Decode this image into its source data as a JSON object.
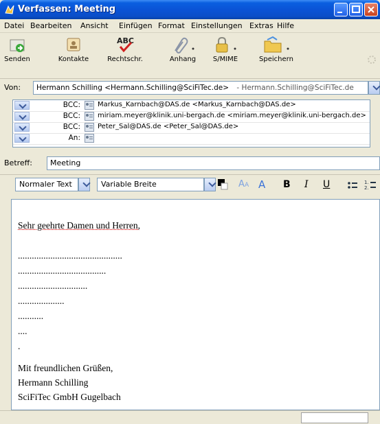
{
  "window": {
    "title": "Verfassen: Meeting"
  },
  "menu": [
    {
      "label": "Datei"
    },
    {
      "label": "Bearbeiten"
    },
    {
      "label": "Ansicht"
    },
    {
      "label": "Einfügen"
    },
    {
      "label": "Format"
    },
    {
      "label": "Einstellungen"
    },
    {
      "label": "Extras"
    },
    {
      "label": "Hilfe"
    }
  ],
  "toolbar": {
    "send": "Senden",
    "contacts": "Kontakte",
    "spell": "Rechtschr.",
    "attach": "Anhang",
    "smime": "S/MIME",
    "save": "Speichern"
  },
  "from": {
    "label": "Von:",
    "value": "Hermann Schilling <Hermann.Schilling@SciFiTec.de>",
    "account": "- Hermann.Schilling@SciFiTec.de"
  },
  "recipients": [
    {
      "type": "BCC:",
      "address": "Markus_Karnbach@DAS.de <Markus_Karnbach@DAS.de>"
    },
    {
      "type": "BCC:",
      "address": "miriam.meyer@klinik.uni-bergach.de <miriam.meyer@klinik.uni-bergach.de>"
    },
    {
      "type": "BCC:",
      "address": "Peter_Sal@DAS.de <Peter_Sal@DAS.de>"
    },
    {
      "type": "An:",
      "address": ""
    }
  ],
  "subject": {
    "label": "Betreff:",
    "value": "Meeting"
  },
  "format": {
    "paragraph": "Normaler Text",
    "font": "Variable Breite",
    "bold": "B",
    "italic": "I",
    "underline": "U"
  },
  "body": {
    "greeting": "Sehr geehrte Damen und Herren,",
    "dots": [
      ".............................................",
      "......................................",
      "..............................",
      "....................",
      "...........",
      "....",
      "."
    ],
    "closing": "Mit freundlichen Grüßen,",
    "name": "Hermann Schilling",
    "company": "SciFiTec GmbH Gugelbach"
  },
  "colors": {
    "titlebar": "#0a53d6",
    "text_color_swatch": "#000000",
    "accent": "#7f9db9"
  }
}
